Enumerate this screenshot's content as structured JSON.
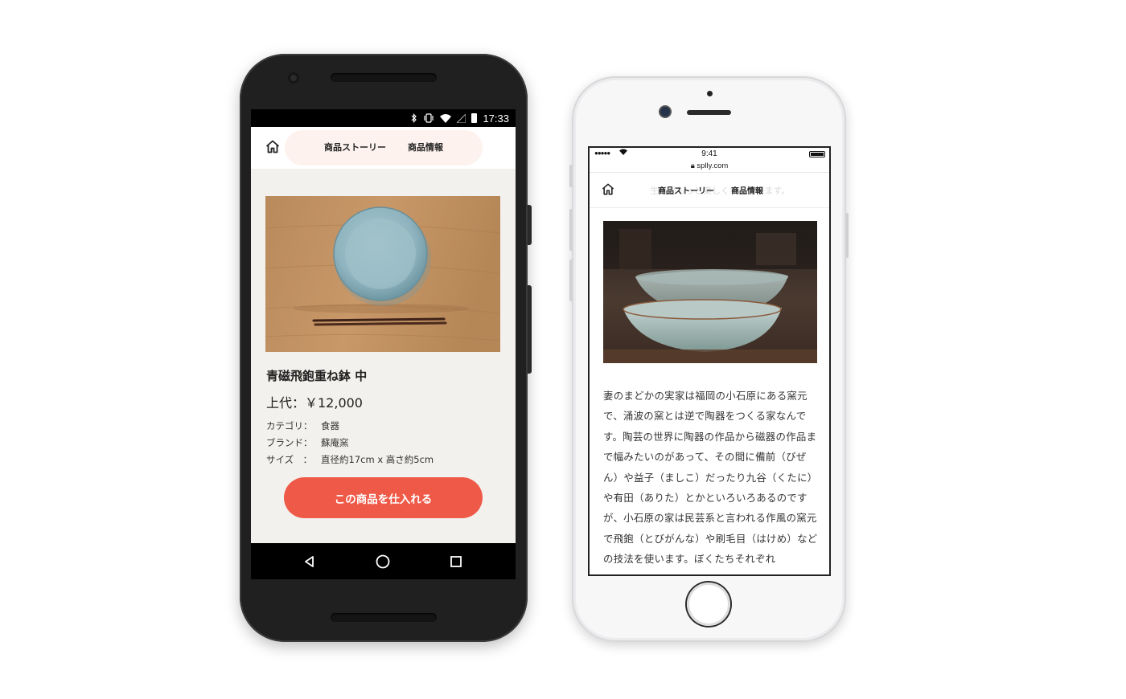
{
  "android": {
    "status_time": "17:33",
    "nav": {
      "tab_story": "商品ストーリー",
      "tab_info": "商品情報"
    },
    "product": {
      "title": "青磁飛鉋重ね鉢 中",
      "price": "上代：￥12,000",
      "specs": [
        {
          "key": "カテゴリ：",
          "value": "食器"
        },
        {
          "key": "ブランド：",
          "value": "蘇庵窯"
        },
        {
          "key": "サイズ　：",
          "value": "直径約17cm x 高さ約5cm"
        }
      ],
      "cta": "この商品を仕入れる"
    },
    "accent_color": "#ef5a48"
  },
  "iphone": {
    "status_time": "9:41",
    "signal": "●●●●●",
    "url": "splly.com",
    "nav": {
      "tab_story": "商品ストーリー",
      "tab_info": "商品情報",
      "ghost_text": "生活がもっと楽しくなっています。"
    },
    "story_text": "妻のまどかの実家は福岡の小石原にある窯元で、涌波の窯とは逆で陶器をつくる家なんです。陶芸の世界に陶器の作品から磁器の作品まで幅みたいのがあって、その間に備前（びぜん）や益子（ましこ）だったり九谷（くたに）や有田（ありた）とかといろいろあるのですが、小石原の家は民芸系と言われる作風の窯元で飛鉋（とびがんな）や刷毛目（はけめ）などの技法を使います。ぼくたちそれぞれ"
  }
}
